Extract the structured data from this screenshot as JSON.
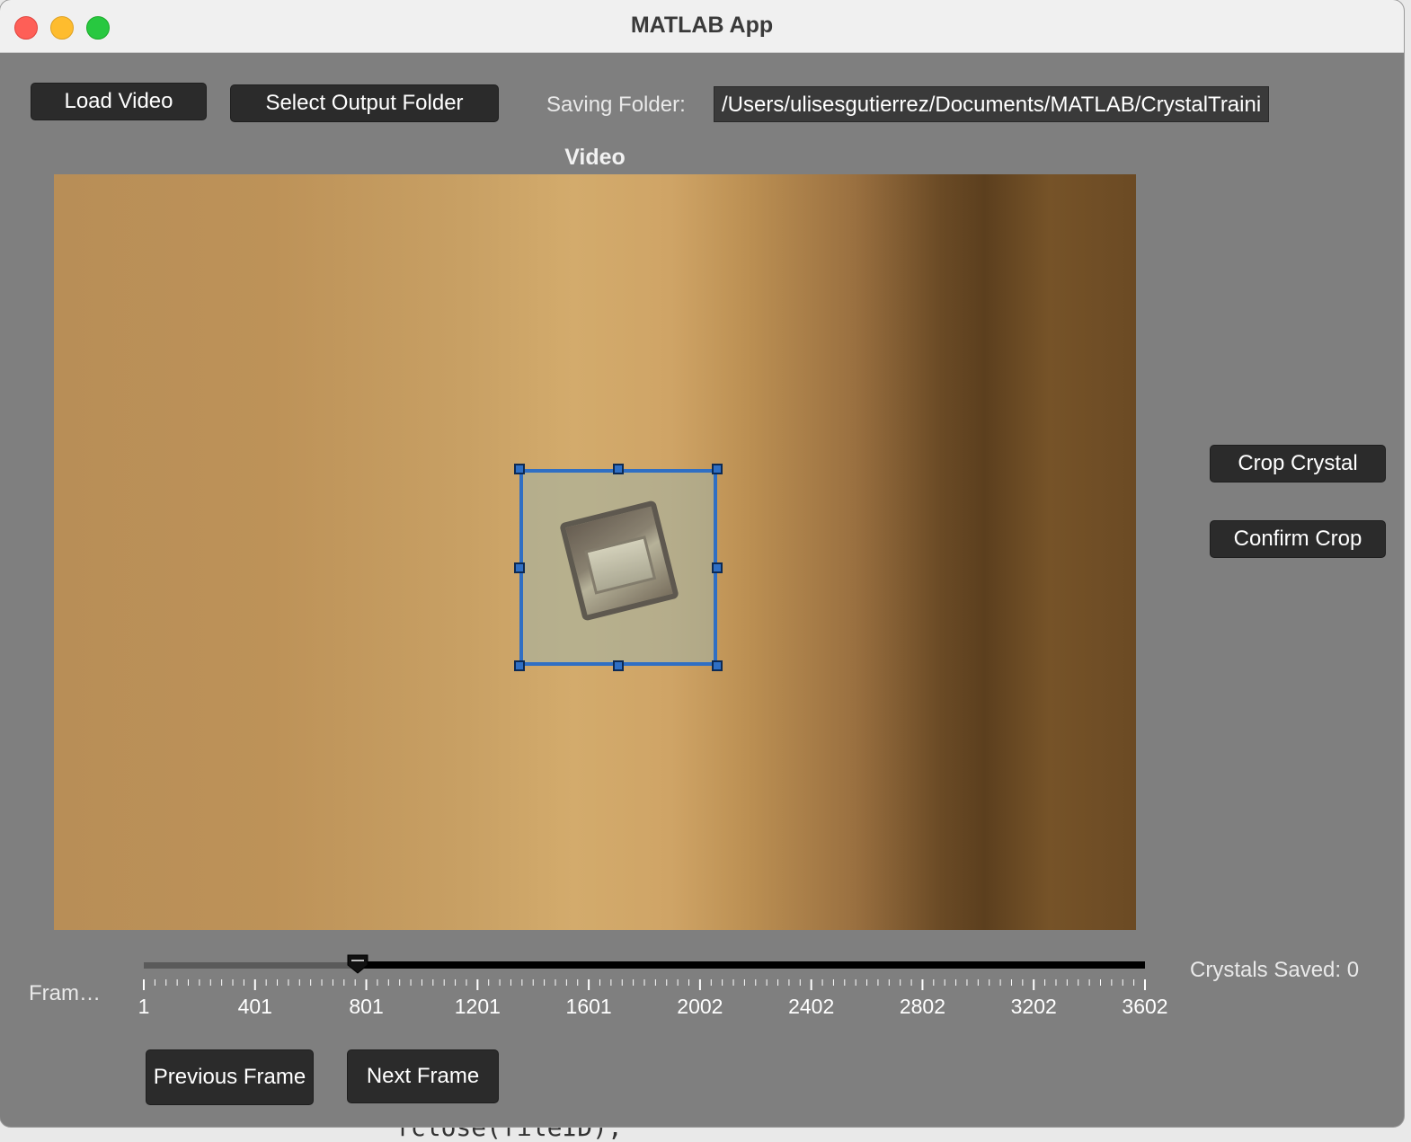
{
  "window": {
    "title": "MATLAB App"
  },
  "toolbar": {
    "load_video_label": "Load Video",
    "select_output_folder_label": "Select Output Folder",
    "saving_folder_label": "Saving Folder:",
    "saving_folder_path": "/Users/ulisesgutierrez/Documents/MATLAB/CrystalTraini"
  },
  "video": {
    "title": "Video"
  },
  "side_buttons": {
    "crop_crystal_label": "Crop Crystal",
    "confirm_crop_label": "Confirm Crop"
  },
  "frame_slider": {
    "label": "Fram…",
    "min": 1,
    "max": 3602,
    "value": 801,
    "tick_labels": [
      "1",
      "401",
      "801",
      "1201",
      "1601",
      "2002",
      "2402",
      "2802",
      "3202",
      "3602"
    ]
  },
  "status": {
    "crystals_saved": "Crystals Saved: 0"
  },
  "nav_buttons": {
    "previous_frame_label": "Previous Frame",
    "next_frame_label": "Next Frame"
  },
  "background_code": "fclose(fileID);",
  "colors": {
    "window_bg": "#7f7f7f",
    "button_bg": "#2b2b2b",
    "crop_rect": "#2f6fc4",
    "titlebar_bg": "#f0f0f0"
  }
}
